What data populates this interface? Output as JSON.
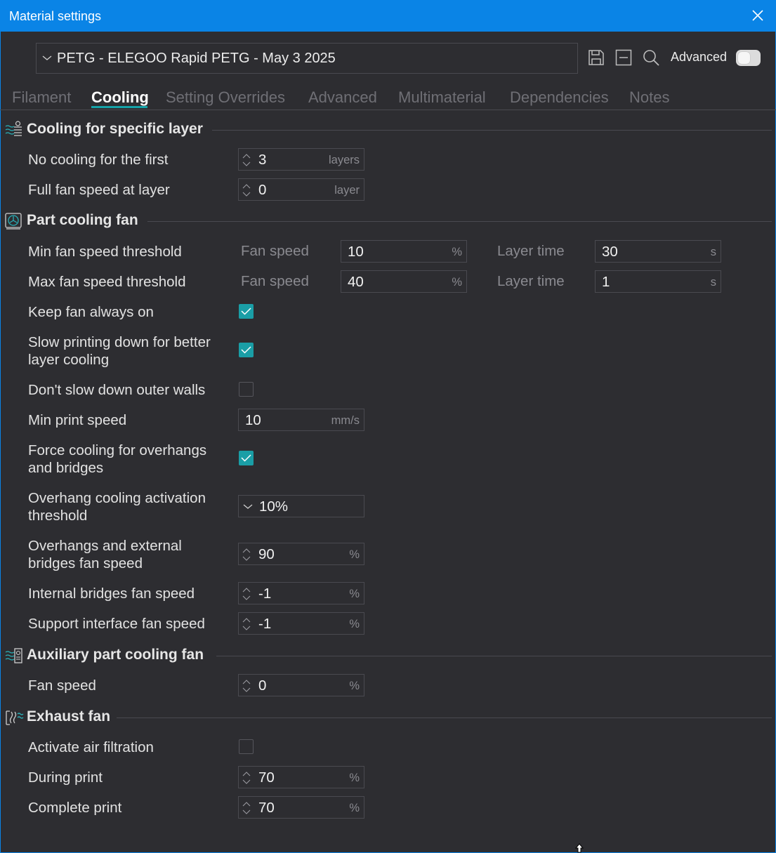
{
  "window": {
    "title": "Material settings"
  },
  "preset": {
    "value": "PETG - ELEGOO Rapid PETG - May 3 2025"
  },
  "toolbar": {
    "save_icon": "save-icon",
    "remove_icon": "remove-preset-icon",
    "search_icon": "search-icon",
    "advanced_label": "Advanced",
    "advanced_enabled": false
  },
  "tabs": [
    {
      "label": "Filament",
      "active": false
    },
    {
      "label": "Cooling",
      "active": true
    },
    {
      "label": "Setting Overrides",
      "active": false
    },
    {
      "label": "Advanced",
      "active": false
    },
    {
      "label": "Multimaterial",
      "active": false
    },
    {
      "label": "Dependencies",
      "active": false
    },
    {
      "label": "Notes",
      "active": false
    }
  ],
  "sections": {
    "specific_layer": {
      "title": "Cooling for specific layer",
      "no_cooling_first": {
        "label": "No cooling for the first",
        "value": "3",
        "unit": "layers"
      },
      "full_fan_speed": {
        "label": "Full fan speed at layer",
        "value": "0",
        "unit": "layer"
      }
    },
    "part_fan": {
      "title": "Part cooling fan",
      "min_threshold": {
        "label": "Min fan speed threshold",
        "fan_label": "Fan speed",
        "fan_value": "10",
        "fan_unit": "%",
        "time_label": "Layer time",
        "time_value": "30",
        "time_unit": "s"
      },
      "max_threshold": {
        "label": "Max fan speed threshold",
        "fan_label": "Fan speed",
        "fan_value": "40",
        "fan_unit": "%",
        "time_label": "Layer time",
        "time_value": "1",
        "time_unit": "s"
      },
      "keep_fan_on": {
        "label": "Keep fan always on",
        "checked": true
      },
      "slow_down": {
        "label_1": "Slow printing down for better",
        "label_2": "layer cooling",
        "checked": true
      },
      "dont_slow_outer": {
        "label": "Don't slow down outer walls",
        "checked": false
      },
      "min_print_speed": {
        "label": "Min print speed",
        "value": "10",
        "unit": "mm/s"
      },
      "force_cooling": {
        "label_1": "Force cooling for overhangs",
        "label_2": "and bridges",
        "checked": true
      },
      "overhang_threshold": {
        "label_1": "Overhang cooling activation",
        "label_2": "threshold",
        "value": "10%"
      },
      "overhang_fan": {
        "label_1": "Overhangs and external",
        "label_2": "bridges fan speed",
        "value": "90",
        "unit": "%"
      },
      "internal_bridges": {
        "label": "Internal bridges fan speed",
        "value": "-1",
        "unit": "%"
      },
      "support_interface": {
        "label": "Support interface fan speed",
        "value": "-1",
        "unit": "%"
      }
    },
    "aux_fan": {
      "title": "Auxiliary part cooling fan",
      "fan_speed": {
        "label": "Fan speed",
        "value": "0",
        "unit": "%"
      }
    },
    "exhaust": {
      "title": "Exhaust fan",
      "air_filtration": {
        "label": "Activate air filtration",
        "checked": false
      },
      "during_print": {
        "label": "During print",
        "value": "70",
        "unit": "%"
      },
      "complete_print": {
        "label": "Complete print",
        "value": "70",
        "unit": "%"
      }
    }
  },
  "colors": {
    "titlebar": "#0a84e6",
    "accent": "#1a9ea6",
    "background": "#2d2d31"
  }
}
